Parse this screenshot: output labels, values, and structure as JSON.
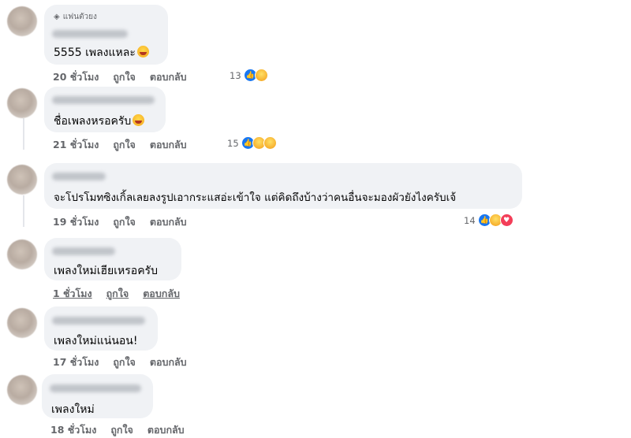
{
  "comments": [
    {
      "badge": "แฟนตัวยง",
      "text": "5555 เพลงแหละ",
      "emoji": "laughing-emoji",
      "time": "20 ชั่วโมง",
      "like": "ถูกใจ",
      "reply": "ตอบกลับ",
      "reaction_count": "13",
      "reactions": [
        "like-icon",
        "haha-icon"
      ]
    },
    {
      "text": "ชื่อเพลงหรอครับ",
      "emoji": "grinning-emoji",
      "time": "21 ชั่วโมง",
      "like": "ถูกใจ",
      "reply": "ตอบกลับ",
      "reaction_count": "15",
      "reactions": [
        "like-icon",
        "haha-icon",
        "care-icon"
      ]
    },
    {
      "text": "จะโปรโมทซิงเกิ้ลเลยลงรูปเอากระแสอ่ะเข้าใจ แต่คิดถึงบ้างว่าคนอื่นจะมองผัวยังไงครับเจ้",
      "time": "19 ชั่วโมง",
      "like": "ถูกใจ",
      "reply": "ตอบกลับ",
      "reaction_count": "14",
      "reactions": [
        "like-icon",
        "haha-icon",
        "love-icon"
      ]
    },
    {
      "text": "เพลงใหม่เฮียเหรอครับ",
      "time": "1 ชั่วโมง",
      "like": "ถูกใจ",
      "reply": "ตอบกลับ"
    },
    {
      "text": "เพลงใหม่แน่นอน!",
      "time": "17 ชั่วโมง",
      "like": "ถูกใจ",
      "reply": "ตอบกลับ"
    },
    {
      "text": "เพลงใหม่",
      "time": "18 ชั่วโมง",
      "like": "ถูกใจ",
      "reply": "ตอบกลับ"
    }
  ],
  "colors": {
    "bubble": "#f0f2f5",
    "meta": "#65676b",
    "like": "#1877f2",
    "love": "#f33e58",
    "haha": "#f7b125"
  }
}
